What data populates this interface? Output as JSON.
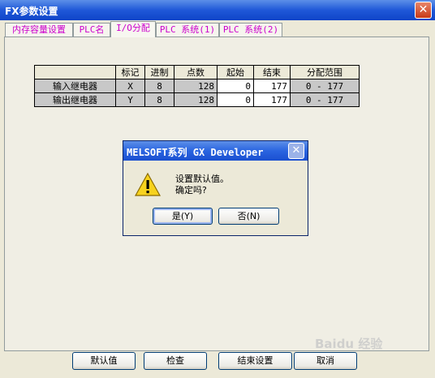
{
  "window": {
    "title": "FX参数设置",
    "close": "✕"
  },
  "tabs": [
    {
      "label": "内存容量设置"
    },
    {
      "label": "PLC名"
    },
    {
      "label": "I/O分配"
    },
    {
      "label": "PLC 系统(1)"
    },
    {
      "label": "PLC 系统(2)"
    }
  ],
  "table": {
    "headers": [
      "标记",
      "进制",
      "点数",
      "起始",
      "结束",
      "分配范围"
    ],
    "rows": [
      {
        "name": "输入继电器",
        "mark": "X",
        "base": "8",
        "points": "128",
        "start": "0",
        "end": "177",
        "range": "0 - 177"
      },
      {
        "name": "输出继电器",
        "mark": "Y",
        "base": "8",
        "points": "128",
        "start": "0",
        "end": "177",
        "range": "0 - 177"
      }
    ]
  },
  "dialog": {
    "title": "MELSOFT系列 GX Developer",
    "line1": "设置默认值。",
    "line2": "确定吗?",
    "yes": "是(Y)",
    "no": "否(N)",
    "close": "✕",
    "icon": "warning-icon"
  },
  "bottom_buttons": {
    "default": "默认值",
    "check": "检查",
    "end": "结束设置",
    "cancel": "取消"
  },
  "watermark": "Baidu 经验"
}
